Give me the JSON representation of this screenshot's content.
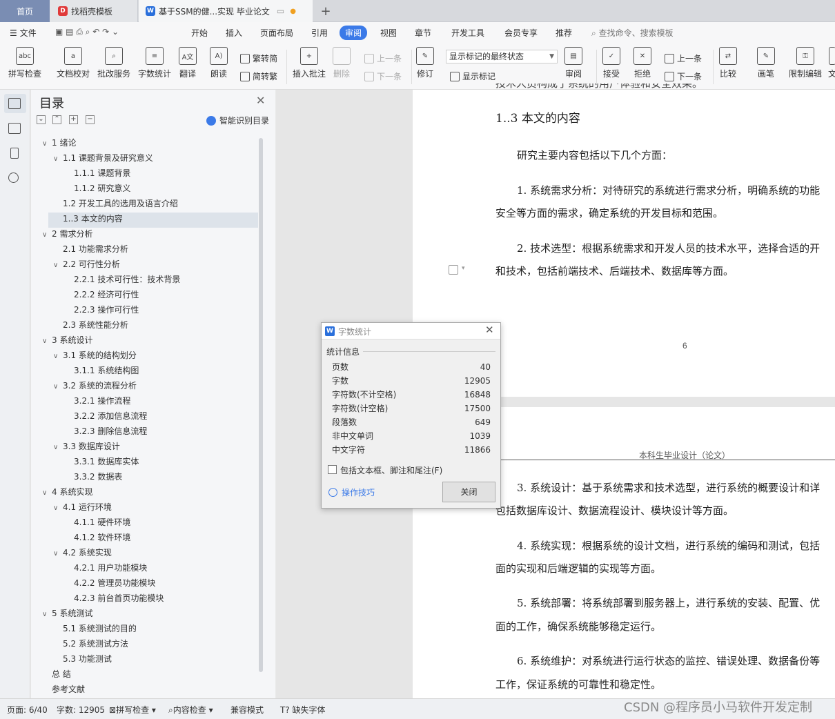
{
  "tabs": {
    "home": "首页",
    "template": "找稻壳模板",
    "document": "基于SSM的健...实现 毕业论文",
    "add": "+"
  },
  "menubar": {
    "file": "文件",
    "items": [
      "开始",
      "插入",
      "页面布局",
      "引用",
      "审阅",
      "视图",
      "章节",
      "开发工具",
      "会员专享",
      "推荐"
    ],
    "search_placeholder": "查找命令、搜索模板"
  },
  "ribbon": {
    "spellcheck": "拼写检查",
    "doc_proof": "文档校对",
    "batch_service": "批改服务",
    "word_count": "字数统计",
    "translate": "翻译",
    "read_aloud": "朗读",
    "trad_to_simp": "繁转简",
    "simp_to_trad": "简转繁",
    "insert_comment": "插入批注",
    "delete": "删除",
    "prev": "上一条",
    "next": "下一条",
    "track": "修订",
    "markup_select": "显示标记的最终状态",
    "show_markup": "显示标记",
    "review": "审阅",
    "accept": "接受",
    "reject": "拒绝",
    "prev2": "上一条",
    "next2": "下一条",
    "compare": "比较",
    "pen": "画笔",
    "restrict": "限制编辑",
    "more": "文"
  },
  "toc": {
    "title": "目录",
    "smart": "智能识别目录",
    "items": [
      {
        "label": "1  绪论",
        "level": 0,
        "caret": "v"
      },
      {
        "label": "1.1  课题背景及研究意义",
        "level": 1,
        "caret": "v"
      },
      {
        "label": "1.1.1  课题背景",
        "level": 2,
        "caret": ""
      },
      {
        "label": "1.1.2  研究意义",
        "level": 2,
        "caret": ""
      },
      {
        "label": "1.2  开发工具的选用及语言介绍",
        "level": 1,
        "caret": ""
      },
      {
        "label": "1..3 本文的内容",
        "level": 1,
        "caret": ""
      },
      {
        "label": "2  需求分析",
        "level": 0,
        "caret": "v"
      },
      {
        "label": "2.1  功能需求分析",
        "level": 1,
        "caret": ""
      },
      {
        "label": "2.2  可行性分析",
        "level": 1,
        "caret": "v"
      },
      {
        "label": "2.2.1 技术可行性：技术背景",
        "level": 2,
        "caret": ""
      },
      {
        "label": "2.2.2 经济可行性",
        "level": 2,
        "caret": ""
      },
      {
        "label": "2.2.3 操作可行性",
        "level": 2,
        "caret": ""
      },
      {
        "label": "2.3 系统性能分析",
        "level": 1,
        "caret": ""
      },
      {
        "label": "3  系统设计",
        "level": 0,
        "caret": "v"
      },
      {
        "label": "3.1  系统的结构划分",
        "level": 1,
        "caret": "v"
      },
      {
        "label": "3.1.1  系统结构图",
        "level": 2,
        "caret": ""
      },
      {
        "label": "3.2  系统的流程分析",
        "level": 1,
        "caret": "v"
      },
      {
        "label": "3.2.1 操作流程",
        "level": 2,
        "caret": ""
      },
      {
        "label": "3.2.2 添加信息流程",
        "level": 2,
        "caret": ""
      },
      {
        "label": "3.2.3 删除信息流程",
        "level": 2,
        "caret": ""
      },
      {
        "label": "3.3 数据库设计",
        "level": 1,
        "caret": "v"
      },
      {
        "label": "3.3.1  数据库实体",
        "level": 2,
        "caret": ""
      },
      {
        "label": "3.3.2 数据表",
        "level": 2,
        "caret": ""
      },
      {
        "label": "4  系统实现",
        "level": 0,
        "caret": "v"
      },
      {
        "label": "4.1  运行环境",
        "level": 1,
        "caret": "v"
      },
      {
        "label": "4.1.1  硬件环境",
        "level": 2,
        "caret": ""
      },
      {
        "label": "4.1.2  软件环境",
        "level": 2,
        "caret": ""
      },
      {
        "label": "4.2  系统实现",
        "level": 1,
        "caret": "v"
      },
      {
        "label": "4.2.1 用户功能模块",
        "level": 2,
        "caret": ""
      },
      {
        "label": "4.2.2 管理员功能模块",
        "level": 2,
        "caret": ""
      },
      {
        "label": "4.2.3 前台首页功能模块",
        "level": 2,
        "caret": ""
      },
      {
        "label": "5  系统测试",
        "level": 0,
        "caret": "v"
      },
      {
        "label": "5.1 系统测试的目的",
        "level": 1,
        "caret": ""
      },
      {
        "label": "5.2 系统测试方法",
        "level": 1,
        "caret": ""
      },
      {
        "label": "5.3 功能测试",
        "level": 1,
        "caret": ""
      },
      {
        "label": "总    结",
        "level": 0,
        "caret": ""
      },
      {
        "label": "参考文献",
        "level": 0,
        "caret": ""
      }
    ]
  },
  "document": {
    "top_clip": "技术人员构成于系统的用户体验和安全效果。",
    "heading": "1..3 本文的内容",
    "intro": "研究主要内容包括以下几个方面：",
    "p1a": "1. 系统需求分析：对待研究的系统进行需求分析，明确系统的功能",
    "p1b": "安全等方面的需求，确定系统的开发目标和范围。",
    "p2a": "2. 技术选型：根据系统需求和开发人员的技术水平，选择合适的开",
    "p2b": "和技术，包括前端技术、后端技术、数据库等方面。",
    "page_number": "6",
    "page_header": "本科生毕业设计（论文）",
    "p3a": "3. 系统设计：基于系统需求和技术选型，进行系统的概要设计和详",
    "p3b": "包括数据库设计、数据流程设计、模块设计等方面。",
    "p4a": "4. 系统实现：根据系统的设计文档，进行系统的编码和测试，包括",
    "p4b": "面的实现和后端逻辑的实现等方面。",
    "p5a": "5. 系统部署：将系统部署到服务器上，进行系统的安装、配置、优",
    "p5b": "面的工作，确保系统能够稳定运行。",
    "p6a": "6. 系统维护：对系统进行运行状态的监控、错误处理、数据备份等",
    "p6b": "工作，保证系统的可靠性和稳定性。"
  },
  "dialog": {
    "title": "字数统计",
    "group": "统计信息",
    "stats": [
      {
        "label": "页数",
        "value": "40"
      },
      {
        "label": "字数",
        "value": "12905"
      },
      {
        "label": "字符数(不计空格)",
        "value": "16848"
      },
      {
        "label": "字符数(计空格)",
        "value": "17500"
      },
      {
        "label": "段落数",
        "value": "649"
      },
      {
        "label": "非中文单词",
        "value": "1039"
      },
      {
        "label": "中文字符",
        "value": "11866"
      }
    ],
    "checkbox": "包括文本框、脚注和尾注(F)",
    "tips": "操作技巧",
    "close": "关闭"
  },
  "status": {
    "page": "页面: 6/40",
    "words": "字数: 12905",
    "spell": "拼写检查",
    "content": "内容检查",
    "compat": "兼容模式",
    "missing_font": "缺失字体"
  },
  "watermark": "CSDN @程序员小马软件开发定制"
}
